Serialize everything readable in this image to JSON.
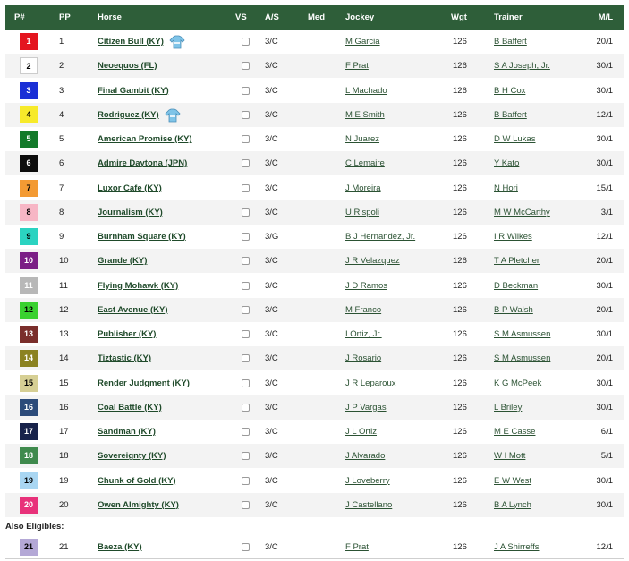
{
  "header": {
    "p_num": "P#",
    "pp": "PP",
    "horse": "Horse",
    "vs": "VS",
    "as": "A/S",
    "med": "Med",
    "jockey": "Jockey",
    "wgt": "Wgt",
    "trainer": "Trainer",
    "ml": "M/L"
  },
  "also_eligibles_label": "Also Eligibles:",
  "rows": [
    {
      "p": "1",
      "pp": "1",
      "horse": "Citizen Bull (KY)",
      "silk": true,
      "as": "3/C",
      "jockey": "M Garcia",
      "wgt": "126",
      "trainer": "B Baffert",
      "ml": "20/1",
      "bg": "#e4151f",
      "fg": "#ffffff"
    },
    {
      "p": "2",
      "pp": "2",
      "horse": "Neoequos (FL)",
      "silk": false,
      "as": "3/C",
      "jockey": "F Prat",
      "wgt": "126",
      "trainer": "S A Joseph, Jr.",
      "ml": "30/1",
      "bg": "#ffffff",
      "fg": "#000000"
    },
    {
      "p": "3",
      "pp": "3",
      "horse": "Final Gambit (KY)",
      "silk": false,
      "as": "3/C",
      "jockey": "L Machado",
      "wgt": "126",
      "trainer": "B H Cox",
      "ml": "30/1",
      "bg": "#1a2fd6",
      "fg": "#ffffff"
    },
    {
      "p": "4",
      "pp": "4",
      "horse": "Rodriguez (KY)",
      "silk": true,
      "as": "3/C",
      "jockey": "M E Smith",
      "wgt": "126",
      "trainer": "B Baffert",
      "ml": "12/1",
      "bg": "#f7ea2a",
      "fg": "#000000"
    },
    {
      "p": "5",
      "pp": "5",
      "horse": "American Promise (KY)",
      "silk": false,
      "as": "3/C",
      "jockey": "N Juarez",
      "wgt": "126",
      "trainer": "D W Lukas",
      "ml": "30/1",
      "bg": "#137a2a",
      "fg": "#ffffff"
    },
    {
      "p": "6",
      "pp": "6",
      "horse": "Admire Daytona (JPN)",
      "silk": false,
      "as": "3/C",
      "jockey": "C Lemaire",
      "wgt": "126",
      "trainer": "Y Kato",
      "ml": "30/1",
      "bg": "#0d0d0d",
      "fg": "#ffffff"
    },
    {
      "p": "7",
      "pp": "7",
      "horse": "Luxor Cafe (KY)",
      "silk": false,
      "as": "3/C",
      "jockey": "J Moreira",
      "wgt": "126",
      "trainer": "N Hori",
      "ml": "15/1",
      "bg": "#f39a33",
      "fg": "#000000"
    },
    {
      "p": "8",
      "pp": "8",
      "horse": "Journalism (KY)",
      "silk": false,
      "as": "3/C",
      "jockey": "U Rispoli",
      "wgt": "126",
      "trainer": "M W McCarthy",
      "ml": "3/1",
      "bg": "#f7b6c5",
      "fg": "#000000"
    },
    {
      "p": "9",
      "pp": "9",
      "horse": "Burnham Square (KY)",
      "silk": false,
      "as": "3/G",
      "jockey": "B J Hernandez, Jr.",
      "wgt": "126",
      "trainer": "I R Wilkes",
      "ml": "12/1",
      "bg": "#2bd3c1",
      "fg": "#000000"
    },
    {
      "p": "10",
      "pp": "10",
      "horse": "Grande (KY)",
      "silk": false,
      "as": "3/C",
      "jockey": "J R Velazquez",
      "wgt": "126",
      "trainer": "T A Pletcher",
      "ml": "20/1",
      "bg": "#7b1f86",
      "fg": "#ffffff"
    },
    {
      "p": "11",
      "pp": "11",
      "horse": "Flying Mohawk (KY)",
      "silk": false,
      "as": "3/C",
      "jockey": "J D Ramos",
      "wgt": "126",
      "trainer": "D Beckman",
      "ml": "30/1",
      "bg": "#b8b8b8",
      "fg": "#ffffff"
    },
    {
      "p": "12",
      "pp": "12",
      "horse": "East Avenue (KY)",
      "silk": false,
      "as": "3/C",
      "jockey": "M Franco",
      "wgt": "126",
      "trainer": "B P Walsh",
      "ml": "20/1",
      "bg": "#39d12f",
      "fg": "#000000"
    },
    {
      "p": "13",
      "pp": "13",
      "horse": "Publisher (KY)",
      "silk": false,
      "as": "3/C",
      "jockey": "I Ortiz, Jr.",
      "wgt": "126",
      "trainer": "S M Asmussen",
      "ml": "30/1",
      "bg": "#7a2e2b",
      "fg": "#ffffff"
    },
    {
      "p": "14",
      "pp": "14",
      "horse": "Tiztastic (KY)",
      "silk": false,
      "as": "3/C",
      "jockey": "J Rosario",
      "wgt": "126",
      "trainer": "S M Asmussen",
      "ml": "20/1",
      "bg": "#8b8221",
      "fg": "#ffffff"
    },
    {
      "p": "15",
      "pp": "15",
      "horse": "Render Judgment (KY)",
      "silk": false,
      "as": "3/C",
      "jockey": "J R Leparoux",
      "wgt": "126",
      "trainer": "K G McPeek",
      "ml": "30/1",
      "bg": "#d6cf94",
      "fg": "#000000"
    },
    {
      "p": "16",
      "pp": "16",
      "horse": "Coal Battle (KY)",
      "silk": false,
      "as": "3/C",
      "jockey": "J P Vargas",
      "wgt": "126",
      "trainer": "L Briley",
      "ml": "30/1",
      "bg": "#2c4b7a",
      "fg": "#ffffff"
    },
    {
      "p": "17",
      "pp": "17",
      "horse": "Sandman (KY)",
      "silk": false,
      "as": "3/C",
      "jockey": "J L Ortiz",
      "wgt": "126",
      "trainer": "M E Casse",
      "ml": "6/1",
      "bg": "#17224a",
      "fg": "#ffffff"
    },
    {
      "p": "18",
      "pp": "18",
      "horse": "Sovereignty (KY)",
      "silk": false,
      "as": "3/C",
      "jockey": "J Alvarado",
      "wgt": "126",
      "trainer": "W I Mott",
      "ml": "5/1",
      "bg": "#3f8a4d",
      "fg": "#ffffff"
    },
    {
      "p": "19",
      "pp": "19",
      "horse": "Chunk of Gold (KY)",
      "silk": false,
      "as": "3/C",
      "jockey": "J Loveberry",
      "wgt": "126",
      "trainer": "E W West",
      "ml": "30/1",
      "bg": "#a9d6f2",
      "fg": "#000000"
    },
    {
      "p": "20",
      "pp": "20",
      "horse": "Owen Almighty (KY)",
      "silk": false,
      "as": "3/C",
      "jockey": "J Castellano",
      "wgt": "126",
      "trainer": "B A Lynch",
      "ml": "30/1",
      "bg": "#e8327a",
      "fg": "#ffffff"
    }
  ],
  "also_rows": [
    {
      "p": "21",
      "pp": "21",
      "horse": "Baeza (KY)",
      "silk": false,
      "as": "3/C",
      "jockey": "F Prat",
      "wgt": "126",
      "trainer": "J A Shirreffs",
      "ml": "12/1",
      "bg": "#b4a8d6",
      "fg": "#000000"
    }
  ]
}
